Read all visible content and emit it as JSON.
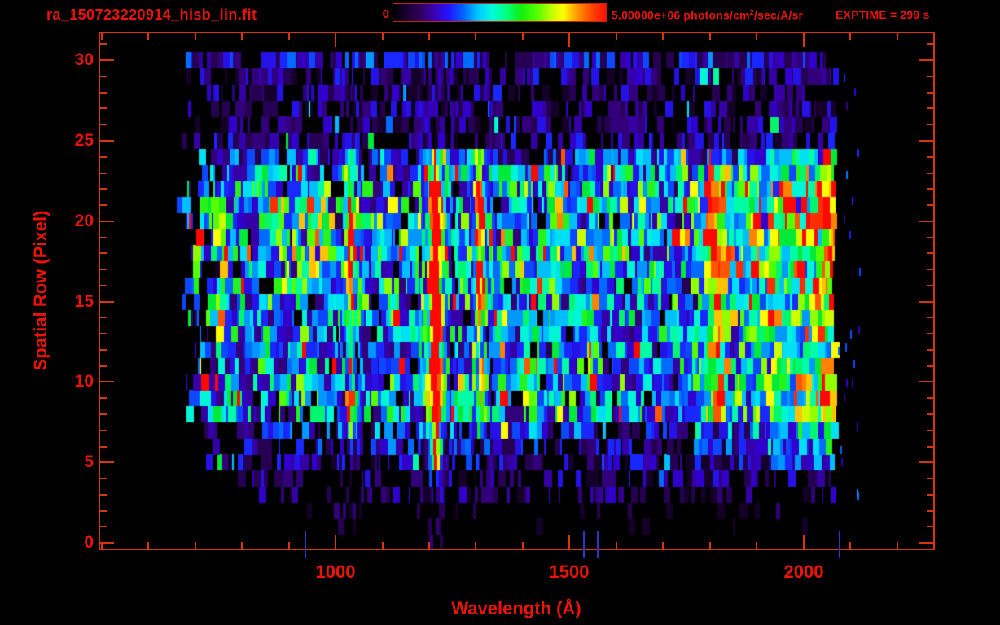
{
  "colors": {
    "background": "#000000",
    "text": "#ed1309",
    "axis": "#d8350f",
    "stray_column": "#2838cc"
  },
  "chart_data": {
    "type": "heatmap",
    "title": "ra_150723220914_hisb_lin.fit",
    "xlabel": "Wavelength (Å)",
    "ylabel": "Spatial Row (Pixel)",
    "exptime_label": "EXPTIME = 299 s",
    "xlim": [
      497,
      2277
    ],
    "ylim": [
      -0.35,
      31.68
    ],
    "x_major_ticks": [
      1000,
      1500,
      2000
    ],
    "x_minor_step": 100,
    "y_major_ticks": [
      0,
      5,
      10,
      15,
      20,
      25,
      30
    ],
    "y_minor_step": 1,
    "grid": false,
    "colorbar": {
      "min_label": "0",
      "max_label_prefix": "5.00000e+06 photons/cm",
      "max_label_sup": "2",
      "max_label_suffix": "/sec/A/sr",
      "gradient": [
        [
          0,
          "#000000"
        ],
        [
          0.05,
          "#16002c"
        ],
        [
          0.12,
          "#2c0054"
        ],
        [
          0.19,
          "#3c00b0"
        ],
        [
          0.26,
          "#2414ff"
        ],
        [
          0.33,
          "#0064ff"
        ],
        [
          0.4,
          "#00c8ff"
        ],
        [
          0.46,
          "#00f8e0"
        ],
        [
          0.53,
          "#00ff84"
        ],
        [
          0.6,
          "#10f010"
        ],
        [
          0.68,
          "#58ff00"
        ],
        [
          0.75,
          "#c8ff00"
        ],
        [
          0.8,
          "#ffff00"
        ],
        [
          0.87,
          "#ff9000"
        ],
        [
          0.94,
          "#ff4000"
        ],
        [
          1,
          "#ff1000"
        ]
      ]
    },
    "colormap": [
      [
        0,
        "#000000"
      ],
      [
        0.06,
        "#200040"
      ],
      [
        0.13,
        "#38008c"
      ],
      [
        0.2,
        "#3000d4"
      ],
      [
        0.27,
        "#1828ff"
      ],
      [
        0.34,
        "#0064ff"
      ],
      [
        0.41,
        "#00b4ff"
      ],
      [
        0.48,
        "#00f0f0"
      ],
      [
        0.55,
        "#00ff96"
      ],
      [
        0.62,
        "#00e830"
      ],
      [
        0.69,
        "#50ff00"
      ],
      [
        0.76,
        "#c0ff00"
      ],
      [
        0.81,
        "#ffff00"
      ],
      [
        0.88,
        "#ff8800"
      ],
      [
        0.95,
        "#ff3800"
      ],
      [
        1,
        "#ff0800"
      ]
    ],
    "wavelength_range": [
      660,
      2066
    ],
    "noise_seed": 20150723,
    "row_levels": [
      0.0,
      0.03,
      0.06,
      0.09,
      0.11,
      0.14,
      0.17,
      0.21,
      0.3,
      0.33,
      0.33,
      0.3,
      0.28,
      0.3,
      0.32,
      0.32,
      0.34,
      0.33,
      0.33,
      0.35,
      0.36,
      0.36,
      0.34,
      0.3,
      0.22,
      0.13,
      0.12,
      0.11,
      0.11,
      0.12,
      0.17
    ],
    "row_coverage": [
      0.02,
      0.1,
      0.28,
      0.4,
      0.5,
      0.58,
      0.65,
      0.75,
      0.92,
      0.93,
      0.93,
      0.92,
      0.9,
      0.92,
      0.93,
      0.93,
      0.93,
      0.93,
      0.93,
      0.94,
      0.94,
      0.94,
      0.93,
      0.92,
      0.85,
      0.68,
      0.66,
      0.65,
      0.66,
      0.7,
      0.8
    ],
    "emission_lines": [
      {
        "wavelength": 1213,
        "core_amp": 1.05,
        "core_sigma": 6,
        "halo_amp": 0.35,
        "halo_sigma": 15,
        "rows": [
          5,
          24
        ],
        "hot_rows": [
          8,
          21
        ],
        "cool_factor": 0.62,
        "foot": 0.16
      },
      {
        "wavelength": 1031,
        "core_amp": 0.52,
        "core_sigma": 5,
        "halo_amp": 0.14,
        "halo_sigma": 12,
        "rows": [
          7,
          24
        ],
        "hot_rows": [
          15,
          22
        ],
        "cool_factor": 0.72
      },
      {
        "wavelength": 1308,
        "core_amp": 0.5,
        "core_sigma": 6,
        "halo_amp": 0.14,
        "halo_sigma": 14,
        "rows": [
          7,
          24
        ],
        "hot_rows": [
          15,
          22
        ],
        "cool_factor": 0.72
      },
      {
        "wavelength": 1356,
        "core_amp": 0.33,
        "core_sigma": 5,
        "rows": [
          9,
          23
        ]
      },
      {
        "wavelength": 1405,
        "core_amp": 0.32,
        "core_sigma": 6,
        "rows": [
          9,
          23
        ]
      },
      {
        "wavelength": 1470,
        "core_amp": 0.38,
        "core_sigma": 7,
        "rows": [
          8,
          23
        ]
      },
      {
        "wavelength": 1550,
        "core_amp": 0.3,
        "core_sigma": 7,
        "rows": [
          9,
          22
        ]
      },
      {
        "wavelength": 1657,
        "core_amp": 0.26,
        "core_sigma": 7,
        "rows": [
          10,
          22
        ]
      },
      {
        "wavelength": 760,
        "core_amp": 0.3,
        "core_sigma": 6,
        "rows": [
          12,
          20
        ]
      },
      {
        "wavelength": 940,
        "core_amp": 0.2,
        "core_sigma": 40,
        "rows": [
          16,
          21
        ]
      },
      {
        "wavelength": 1812,
        "core_amp": 0.42,
        "core_sigma": 14,
        "halo_amp": 0.1,
        "halo_sigma": 30,
        "rows": [
          8,
          23
        ],
        "hot_rows": [
          17,
          22
        ],
        "cool_factor": 0.8
      }
    ],
    "continuum_ramp": {
      "start": 1620,
      "end": 2065,
      "max_amp": 0.5,
      "rows": [
        5,
        24
      ]
    },
    "edge_hotspots": {
      "range": [
        2050,
        2066
      ],
      "amp": [
        0.58,
        0.95
      ],
      "probability": 0.45,
      "rows": [
        5,
        24
      ]
    },
    "stray_columns": [
      934,
      1529,
      1558,
      2076
    ]
  }
}
